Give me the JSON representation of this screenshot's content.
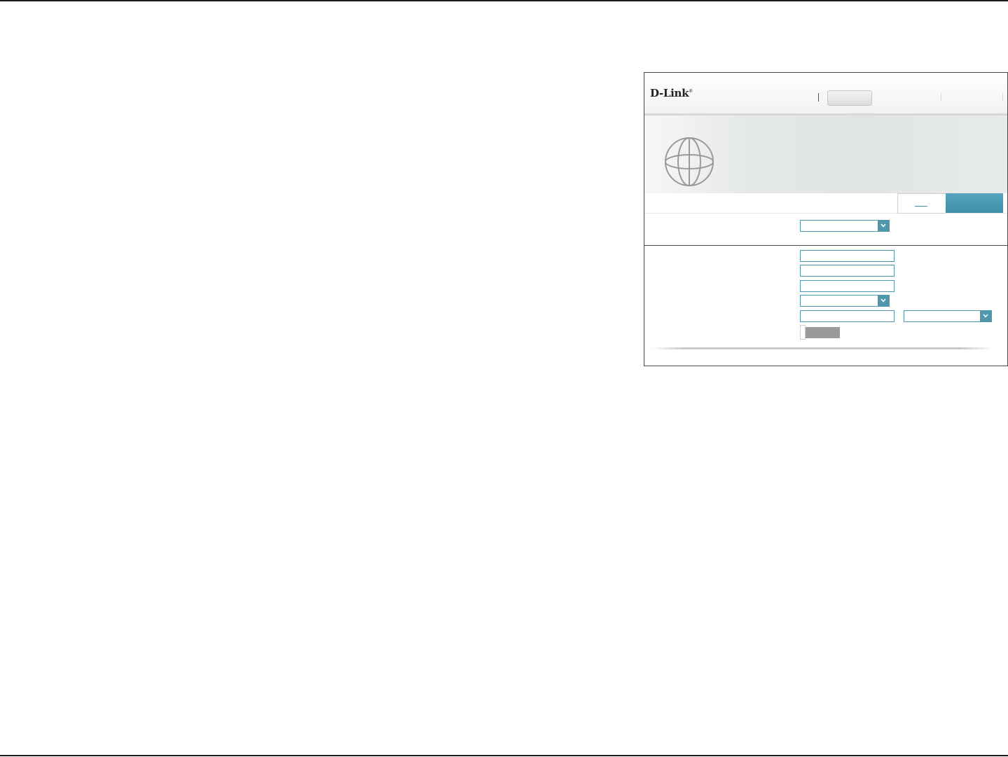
{
  "header": {
    "logo_text": "D-Link",
    "logo_mark": "®",
    "active_tab_label": ""
  },
  "hero": {
    "icon": "globe-icon"
  },
  "actions": {
    "link_label": "",
    "save_label": ""
  },
  "form": {
    "connection_type": {
      "value": ""
    },
    "fields": [
      {
        "value": ""
      },
      {
        "value": ""
      },
      {
        "value": ""
      }
    ],
    "dropdown": {
      "value": ""
    },
    "paired_input": {
      "value": ""
    },
    "paired_dropdown": {
      "value": ""
    }
  },
  "colors": {
    "accent": "#4e97ad",
    "save_button": "#4a9ab6",
    "toggle_off": "#9a9a9a"
  }
}
